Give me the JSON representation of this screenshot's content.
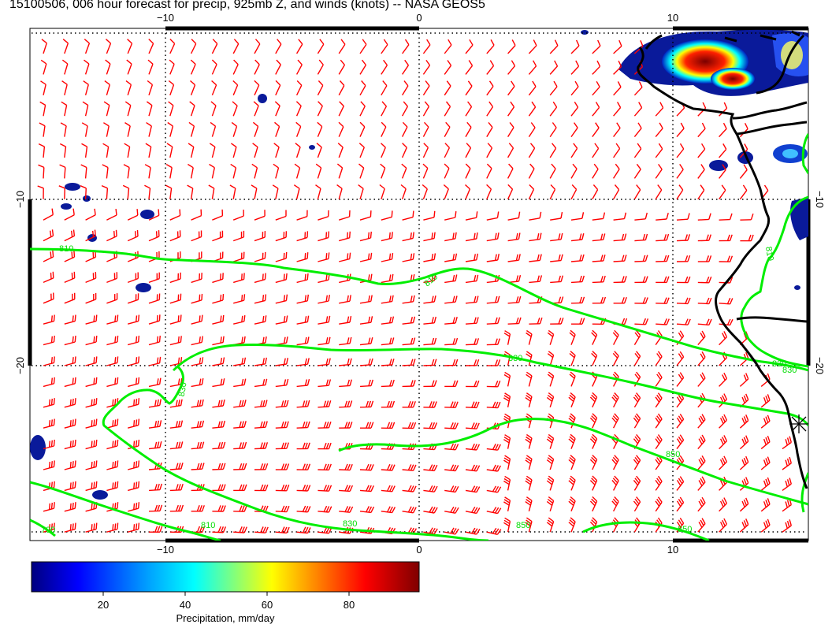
{
  "title": "15100506, 006 hour forecast for precip, 925mb Z, and winds (knots) -- NASA GEOS5",
  "map": {
    "lon_ticks_top": [
      "−10",
      "0",
      "10"
    ],
    "lon_ticks_bottom": [
      "−10",
      "0",
      "10"
    ],
    "lat_ticks_left": [
      "−10",
      "−20"
    ],
    "lat_ticks_right": [
      "−10",
      "−20"
    ],
    "contour_labels": [
      "810",
      "810",
      "810",
      "830",
      "830",
      "830",
      "830",
      "850",
      "850",
      "790",
      "810",
      "830",
      "850"
    ],
    "colors": {
      "wind_barbs": "#ff0000",
      "contours": "#00ee00",
      "coastline": "#000000",
      "precip_low": "#00008b",
      "precip_high": "#7a0000"
    }
  },
  "colorbar": {
    "ticks": [
      "20",
      "40",
      "60",
      "80"
    ],
    "label": "Precipitation, mm/day",
    "stops": [
      "#00007f",
      "#0000ff",
      "#00a0ff",
      "#00ffff",
      "#7fff7f",
      "#ffff00",
      "#ff8000",
      "#ff0000",
      "#7f0000"
    ]
  }
}
